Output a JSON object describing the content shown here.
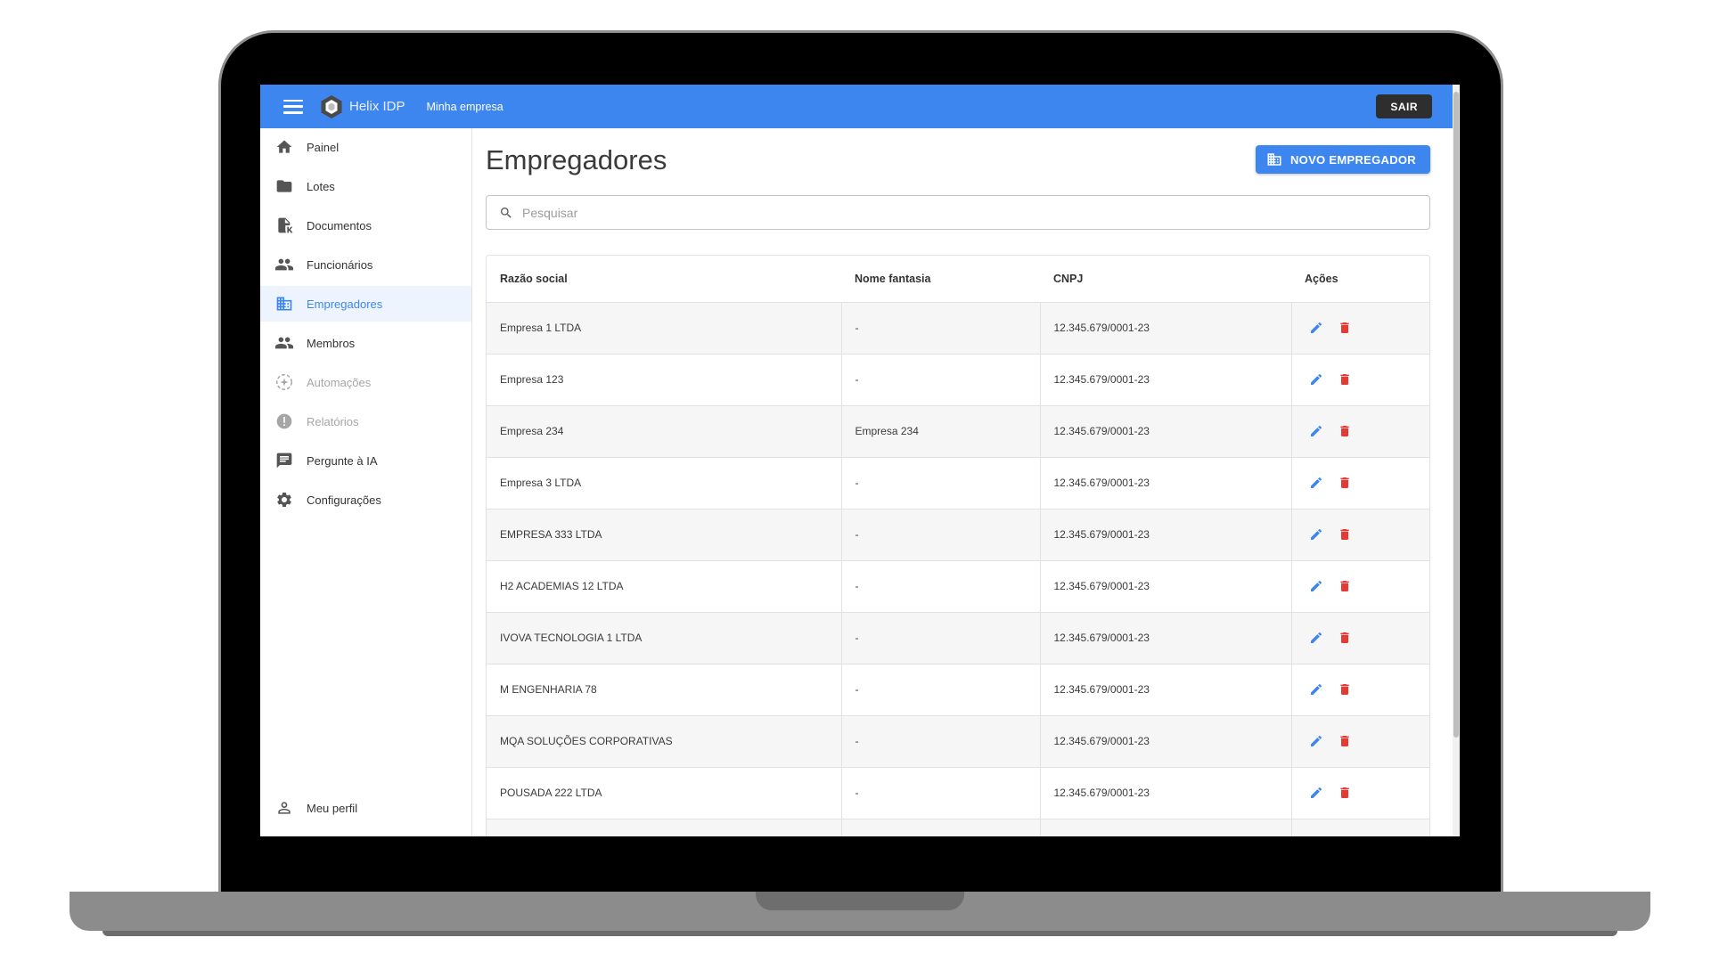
{
  "app": {
    "name": "Helix IDP",
    "company": "Minha empresa",
    "logout_label": "SAIR",
    "accent": "#3d86f0",
    "danger": "#e53935"
  },
  "sidebar": {
    "items": [
      {
        "label": "Painel",
        "icon": "home-icon"
      },
      {
        "label": "Lotes",
        "icon": "folder-icon"
      },
      {
        "label": "Documentos",
        "icon": "document-icon"
      },
      {
        "label": "Funcionários",
        "icon": "people-icon"
      },
      {
        "label": "Empregadores",
        "icon": "building-icon",
        "active": true
      },
      {
        "label": "Membros",
        "icon": "people-icon"
      },
      {
        "label": "Automações",
        "icon": "automation-icon",
        "disabled": true
      },
      {
        "label": "Relatórios",
        "icon": "alert-icon",
        "disabled": true
      },
      {
        "label": "Pergunte à IA",
        "icon": "chat-icon"
      },
      {
        "label": "Configurações",
        "icon": "gear-icon"
      }
    ],
    "profile_label": "Meu perfil"
  },
  "main": {
    "title": "Empregadores",
    "new_button_label": "NOVO EMPREGADOR",
    "search_placeholder": "Pesquisar",
    "table": {
      "headers": [
        "Razão social",
        "Nome fantasia",
        "CNPJ",
        "Ações"
      ],
      "rows": [
        [
          "Empresa 1 LTDA",
          "-",
          "12.345.679/0001-23"
        ],
        [
          "Empresa 123",
          "-",
          "12.345.679/0001-23"
        ],
        [
          "Empresa 234",
          "Empresa 234",
          "12.345.679/0001-23"
        ],
        [
          "Empresa 3 LTDA",
          "-",
          "12.345.679/0001-23"
        ],
        [
          "EMPRESA 333 LTDA",
          "-",
          "12.345.679/0001-23"
        ],
        [
          "H2 ACADEMIAS 12 LTDA",
          "-",
          "12.345.679/0001-23"
        ],
        [
          "IVOVA TECNOLOGIA 1 LTDA",
          "-",
          "12.345.679/0001-23"
        ],
        [
          "M ENGENHARIA 78",
          "-",
          "12.345.679/0001-23"
        ],
        [
          "MQA SOLUÇÕES CORPORATIVAS",
          "-",
          "12.345.679/0001-23"
        ],
        [
          "POUSADA 222 LTDA",
          "-",
          "12.345.679/0001-23"
        ],
        [
          "",
          "",
          ""
        ]
      ]
    }
  }
}
